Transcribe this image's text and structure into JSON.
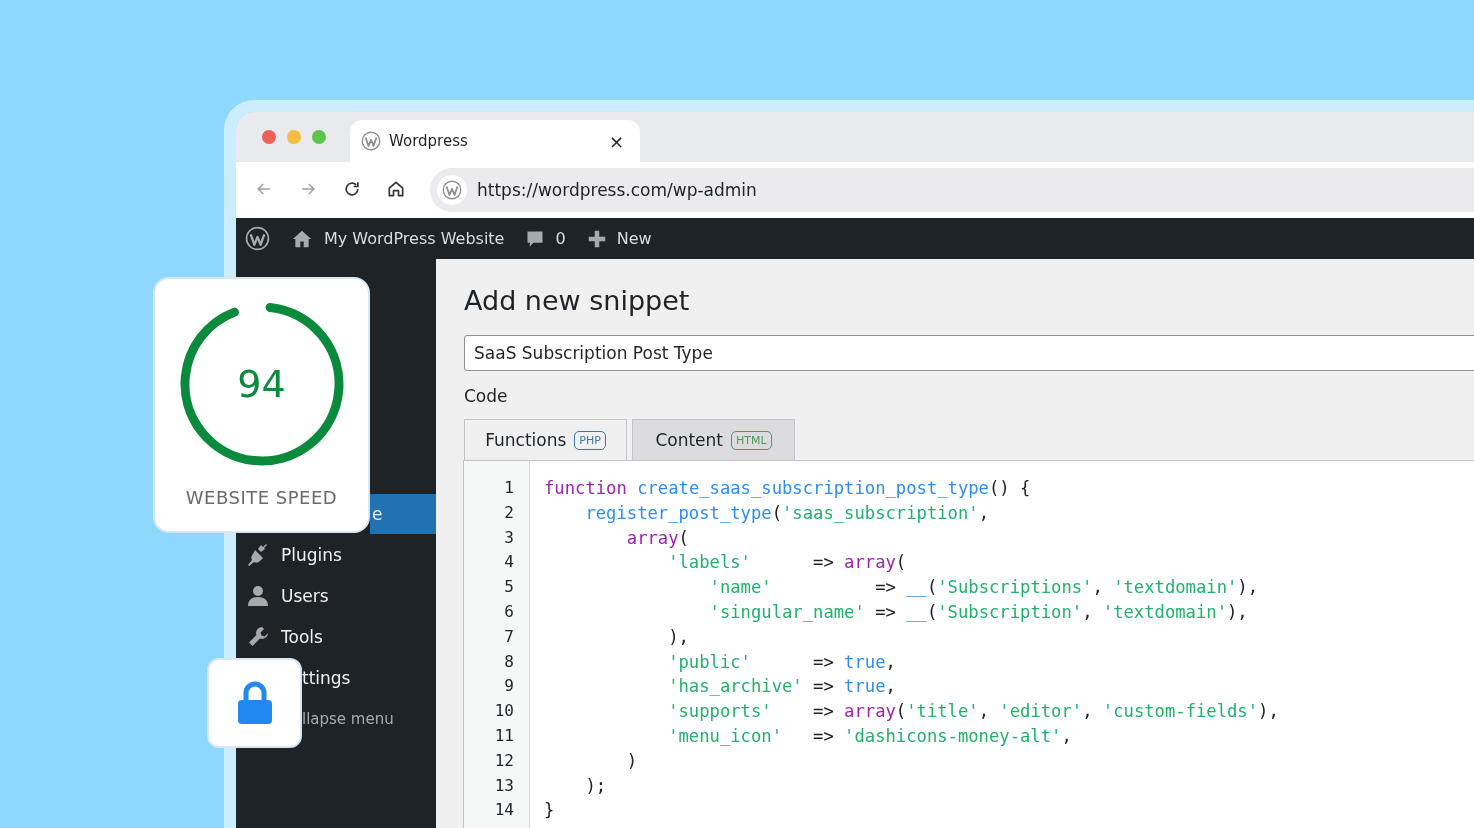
{
  "browser": {
    "tab": {
      "title": "Wordpress",
      "close": "×"
    },
    "nav_buttons": [
      {
        "kind": "back",
        "disabled": true
      },
      {
        "kind": "forward",
        "disabled": true
      },
      {
        "kind": "reload",
        "disabled": false
      },
      {
        "kind": "home",
        "disabled": false
      }
    ],
    "url": "https://wordpress.com/wp-admin"
  },
  "admin_bar": {
    "site_name": "My WordPress Website",
    "comments": "0",
    "new_label": "New"
  },
  "sidebar": {
    "items": [
      {
        "label": "e",
        "kind": "behind_speed",
        "selected": true
      },
      {
        "label": "Plugins",
        "kind": "plugins",
        "selected": false
      },
      {
        "label": "Users",
        "kind": "users",
        "selected": false
      },
      {
        "label": "Tools",
        "kind": "tools",
        "selected": false
      },
      {
        "label": "ttings",
        "kind": "behind_lock",
        "selected": false
      },
      {
        "label": "llapse menu",
        "kind": "behind_lock_dim",
        "selected": false
      }
    ]
  },
  "page": {
    "title": "Add new snippet",
    "snippet_name": "SaaS Subscription Post Type",
    "code_label": "Code",
    "tabs": [
      {
        "label": "Functions",
        "badge": "PHP",
        "color": "#3b7a9e",
        "selected": true
      },
      {
        "label": "Content",
        "badge": "HTML",
        "color": "#4f9a5e",
        "selected": false
      }
    ],
    "code_lines": [
      {
        "number": "1",
        "tokens": [
          {
            "kind": "keyword",
            "text": "function "
          },
          {
            "kind": "function",
            "text": "create_saas_subscription_post_type"
          },
          {
            "kind": "plain",
            "text": "() {"
          }
        ]
      },
      {
        "number": "2",
        "tokens": [
          {
            "kind": "function",
            "text": "    register_post_type"
          },
          {
            "kind": "plain",
            "text": "("
          },
          {
            "kind": "string",
            "text": "'saas_subscription'"
          },
          {
            "kind": "plain",
            "text": ","
          }
        ]
      },
      {
        "number": "3",
        "tokens": [
          {
            "kind": "keyword",
            "text": "        array"
          },
          {
            "kind": "plain",
            "text": "("
          }
        ]
      },
      {
        "number": "4",
        "tokens": [
          {
            "kind": "string",
            "text": "            'labels'"
          },
          {
            "kind": "plain",
            "text": "      => "
          },
          {
            "kind": "keyword",
            "text": "array"
          },
          {
            "kind": "plain",
            "text": "("
          }
        ]
      },
      {
        "number": "5",
        "tokens": [
          {
            "kind": "string",
            "text": "                'name'"
          },
          {
            "kind": "plain",
            "text": "          => "
          },
          {
            "kind": "function",
            "text": "__"
          },
          {
            "kind": "plain",
            "text": "("
          },
          {
            "kind": "string",
            "text": "'Subscriptions'"
          },
          {
            "kind": "plain",
            "text": ", "
          },
          {
            "kind": "string",
            "text": "'textdomain'"
          },
          {
            "kind": "plain",
            "text": "),"
          }
        ]
      },
      {
        "number": "6",
        "tokens": [
          {
            "kind": "string",
            "text": "                'singular_name'"
          },
          {
            "kind": "plain",
            "text": " => "
          },
          {
            "kind": "function",
            "text": "__"
          },
          {
            "kind": "plain",
            "text": "("
          },
          {
            "kind": "string",
            "text": "'Subscription'"
          },
          {
            "kind": "plain",
            "text": ", "
          },
          {
            "kind": "string",
            "text": "'textdomain'"
          },
          {
            "kind": "plain",
            "text": "),"
          }
        ]
      },
      {
        "number": "7",
        "tokens": [
          {
            "kind": "plain",
            "text": "            ),"
          }
        ]
      },
      {
        "number": "8",
        "tokens": [
          {
            "kind": "string",
            "text": "            'public'"
          },
          {
            "kind": "plain",
            "text": "      => "
          },
          {
            "kind": "constant",
            "text": "true"
          },
          {
            "kind": "plain",
            "text": ","
          }
        ]
      },
      {
        "number": "9",
        "tokens": [
          {
            "kind": "string",
            "text": "            'has_archive'"
          },
          {
            "kind": "plain",
            "text": " => "
          },
          {
            "kind": "constant",
            "text": "true"
          },
          {
            "kind": "plain",
            "text": ","
          }
        ]
      },
      {
        "number": "10",
        "tokens": [
          {
            "kind": "string",
            "text": "            'supports'"
          },
          {
            "kind": "plain",
            "text": "    => "
          },
          {
            "kind": "keyword",
            "text": "array"
          },
          {
            "kind": "plain",
            "text": "("
          },
          {
            "kind": "string",
            "text": "'title'"
          },
          {
            "kind": "plain",
            "text": ", "
          },
          {
            "kind": "string",
            "text": "'editor'"
          },
          {
            "kind": "plain",
            "text": ", "
          },
          {
            "kind": "string",
            "text": "'custom-fields'"
          },
          {
            "kind": "plain",
            "text": "),"
          }
        ]
      },
      {
        "number": "11",
        "tokens": [
          {
            "kind": "string",
            "text": "            'menu_icon'"
          },
          {
            "kind": "plain",
            "text": "   => "
          },
          {
            "kind": "string",
            "text": "'dashicons-money-alt'"
          },
          {
            "kind": "plain",
            "text": ","
          }
        ]
      },
      {
        "number": "12",
        "tokens": [
          {
            "kind": "plain",
            "text": "        )"
          }
        ]
      },
      {
        "number": "13",
        "tokens": [
          {
            "kind": "plain",
            "text": "    );"
          }
        ]
      },
      {
        "number": "14",
        "tokens": [
          {
            "kind": "plain",
            "text": "}"
          }
        ]
      }
    ]
  },
  "speed_card": {
    "score": "94",
    "level": 0.94,
    "label": "WEBSITE SPEED"
  },
  "lock_card": {
    "locked": true
  }
}
